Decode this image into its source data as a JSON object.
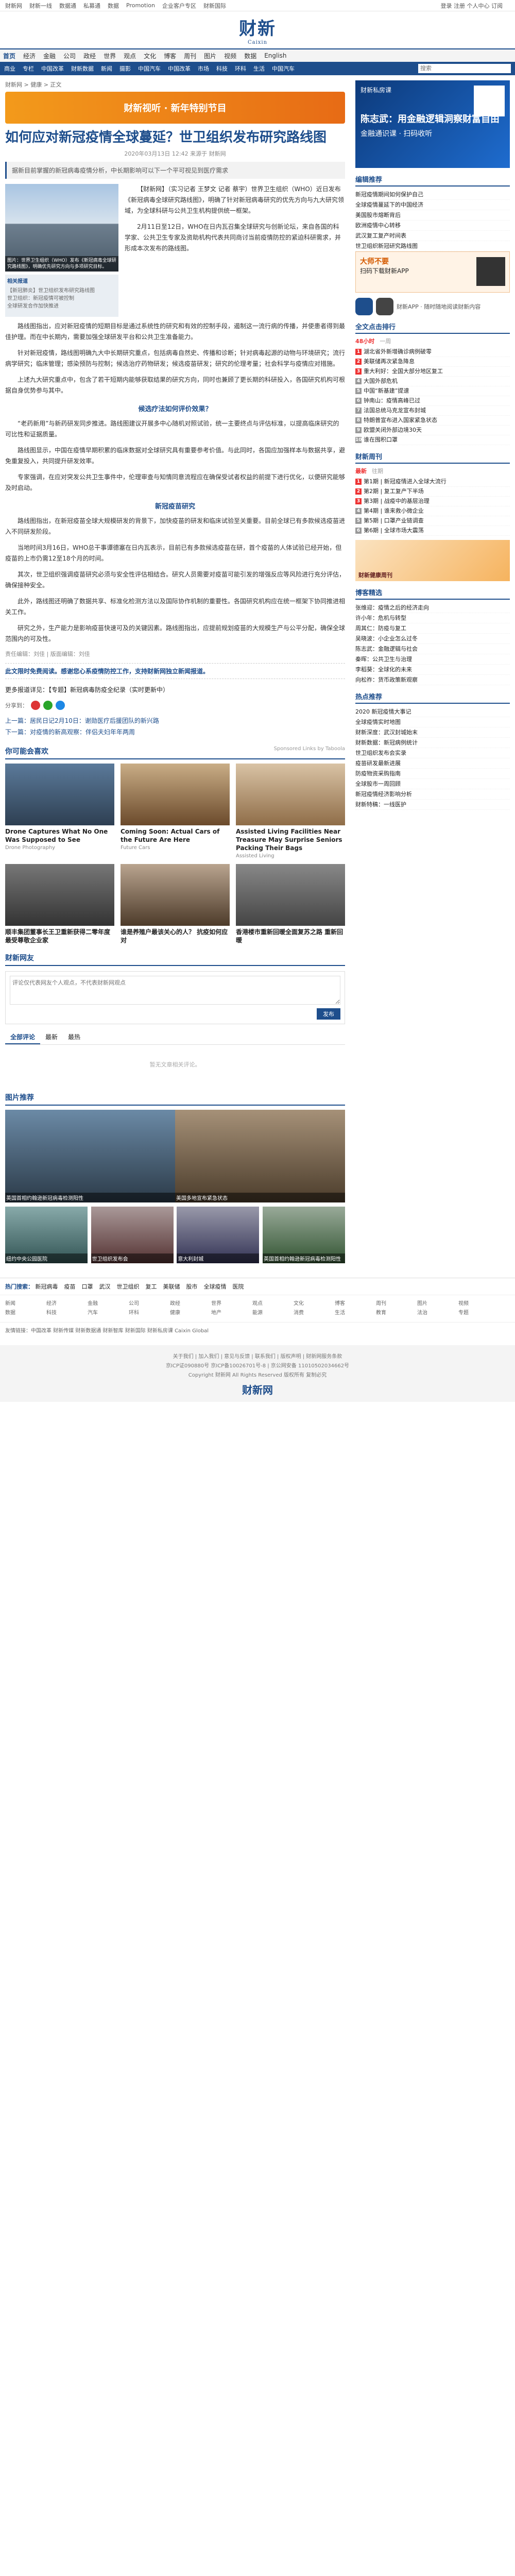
{
  "topbar": {
    "items": [
      "财新网",
      "财新一线",
      "数据通",
      "私募通",
      "数据",
      "Promotion",
      "企业客户专区",
      "财新国际"
    ],
    "right": "登录  注册  个人中心  订阅"
  },
  "logo": {
    "cn": "财新",
    "en": "Caixin"
  },
  "nav": {
    "items": [
      "首页",
      "经济",
      "金融",
      "公司",
      "政经",
      "世界",
      "观点",
      "文化",
      "博客",
      "周刊",
      "图片",
      "视频",
      "数据",
      "English"
    ],
    "sub": [
      "商业",
      "专栏",
      "中国改革",
      "财新数据",
      "新闻",
      "摄影",
      "中国汽车",
      "中国改革",
      "市场",
      "科技",
      "环科",
      "生活",
      "中国汽车"
    ]
  },
  "search": {
    "placeholder": "搜索"
  },
  "breadcrumb": "财新网 > 健康 > 正文",
  "ad_strip": "财新视听 · 新年特别节目",
  "article": {
    "title": "如何应对新冠疫情全球蔓延？世卫组织发布研究路线图",
    "meta": "2020年03月13日 12:42  来源于 财新网",
    "summary": "据新目前掌握的新冠病毒疫情分析，中长期影响可以下一个平可视见到医疗需求",
    "photo_caption": "图片：世界卫生组织（WHO）发布《新冠病毒全球研究路线图》，明确优先研究方向与多项研究目标。",
    "related_head": "相关报道",
    "related": [
      "【新冠肺炎】世卫组织发布研究路线图",
      "世卫组织：新冠疫情可被控制",
      "全球研发合作加快推进"
    ],
    "paragraphs": [
      "【财新网】（实习记者 王梦文 记者 蔡宇）世界卫生组织（WHO）近日发布《新冠病毒全球研究路线图》，明确了针对新冠病毒研究的优先方向与九大研究领域，为全球科研与公共卫生机构提供统一框架。",
      "2月11日至12日，WHO在日内瓦召集全球研究与创新论坛，来自各国的科学家、公共卫生专家及资助机构代表共同商讨当前疫情防控的紧迫科研需求，并形成本次发布的路线图。",
      "路线图指出，应对新冠疫情的短期目标是通过系统性的研究和有效的控制手段，遏制这一流行病的传播，并使患者得到最佳护理。而在中长期内，需要加强全球研发平台和公共卫生准备能力。",
      "针对新冠疫情，路线图明确九大中长期研究重点，包括病毒自然史、传播和诊断；针对病毒起源的动物与环境研究；流行病学研究；临床管理；感染预防与控制；候选治疗药物研发；候选疫苗研发；研究的伦理考量；社会科学与疫情应对措施。",
      "上述九大研究重点中，包含了若干短期内能够获取结果的研究方向，同时也兼顾了更长期的科研投入，各国研究机构可根据自身优势参与其中。"
    ],
    "h_mid": "候选疗法如何评价效果？",
    "paragraphs2": [
      "“老药新用”与新药研发同步推进。路线图建议开展多中心随机对照试验，统一主要终点与评估标准，以提高临床研究的可比性和证据质量。",
      "路线图显示，中国在疫情早期积累的临床数据对全球研究具有重要参考价值。与此同时，各国应加强样本与数据共享，避免重复投入，共同提升研发效率。",
      "专家强调，在应对突发公共卫生事件中，伦理审查与知情同意流程应在确保受试者权益的前提下进行优化，以便研究能够及时启动。"
    ],
    "h_mid2": "新冠疫苗研究",
    "paragraphs3": [
      "路线图指出，在新冠疫苗全球大规模研发的背景下，加快疫苗的研发和临床试验至关重要。目前全球已有多款候选疫苗进入不同研发阶段。",
      "当地时间3月16日，WHO总干事谭德塞在日内瓦表示，目前已有多款候选疫苗在研，首个疫苗的人体试验已经开始，但疫苗的上市仍需12至18个月的时间。",
      "其次，世卫组织强调疫苗研究必须与安全性评估相结合。研究人员需要对疫苗可能引发的增强反应等风险进行充分评估，确保接种安全。",
      "此外，路线图还明确了数据共享、标准化检测方法以及国际协作机制的重要性。各国研究机构应在统一框架下协同推进相关工作。",
      "研究之外，生产能力是影响疫苗快速可及的关键因素。路线图指出，应提前规划疫苗的大规模生产与公平分配，确保全球范围内的可及性。"
    ],
    "editor": "责任编辑：刘佳  |  版面编辑：刘佳",
    "notice": "此文限时免费阅读。感谢您心系疫情防控工作，支持财新网独立新闻报道。",
    "more_label": "更多报道详见：【专题】新冠病毒防疫全纪录（实时更新中）"
  },
  "share": {
    "label": "分享到："
  },
  "links": {
    "prev": "上一篇：居民日记2月10日：谢勋医疗后援团队的新兴路",
    "next": "下一篇：对疫情的新高观察：伴侣夫妇年年两周"
  },
  "recommend": {
    "title": "你可能会喜欢",
    "sponsored": "Sponsored Links by Taboola",
    "cards": [
      {
        "t": "Drone Captures What No One Was Supposed to See",
        "s": "Drone Photography"
      },
      {
        "t": "Coming Soon: Actual Cars of the Future Are Here",
        "s": "Future Cars"
      },
      {
        "t": "Assisted Living Facilities Near Treasure May Surprise Seniors Packing Their Bags",
        "s": "Assisted Living"
      }
    ],
    "cards2": [
      {
        "t": "顺丰集团董事长王卫重新获得二零年度最受尊敬企业家",
        "s": ""
      },
      {
        "t": "谁是养殖户最该关心的人？ 抗疫如何应对",
        "s": ""
      },
      {
        "t": "香港楼市重新回暖全面复苏之路 重新回暖",
        "s": ""
      }
    ]
  },
  "comments": {
    "title": "财新网友",
    "placeholder": "评论仅代表网友个人观点，不代表财新网观点",
    "submit": "发布",
    "tabs": [
      "全部评论",
      "最新",
      "最热"
    ],
    "empty": "暂无文章相关评论。"
  },
  "photos": {
    "title": "图片推荐",
    "items": [
      "英国首相约翰逊新冠病毒检测阳性",
      "美国多地宣布紧急状态",
      "纽约中央公园医院",
      "世卫组织发布会",
      "意大利封城"
    ]
  },
  "sidebar": {
    "ad1": {
      "top": "财新私房课",
      "big": "陈志武：用金融逻辑洞察财富自由",
      "mid": "金融通识课 · 扫码收听"
    },
    "hot_title": "编辑推荐",
    "hot": [
      "新冠疫情期间如何保护自己",
      "全球疫情蔓延下的中国经济",
      "美国股市熔断背后",
      "欧洲疫情中心转移",
      "武汉复工复产时间表",
      "世卫组织新冠研究路线图"
    ],
    "ad2": {
      "b": "大师不要",
      "s": "扫码下载财新APP"
    },
    "app_label": "财新APP · 随时随地阅读财新内容",
    "rank_title": "全文点击排行",
    "rank_tabs": [
      "48小时",
      "一周"
    ],
    "rank": [
      "湖北省外新增确诊病例破零",
      "美联储再次紧急降息",
      "重大利好：全国大部分地区复工",
      "大国外部危机",
      "中国“新基建”提速",
      "钟南山：疫情高峰已过",
      "法国总统马克龙宣布封城",
      "特朗普宣布进入国家紧急状态",
      "欧盟关闭外部边境30天",
      "谁在囤积口罩"
    ],
    "latest_title": "财新周刊",
    "latest_tabs": [
      "最新",
      "往期"
    ],
    "latest": [
      "第1期 | 新冠疫情进入全球大流行",
      "第2期 | 复工复产下半场",
      "第3期 | 战疫中的基层治理",
      "第4期 | 谁来救小微企业",
      "第5期 | 口罩产业链调查",
      "第6期 | 全球市场大震荡"
    ],
    "img_label": "财新健康周刊",
    "blog_title": "博客精选",
    "blog": [
      "张维迎：疫情之后的经济走向",
      "许小年：危机与转型",
      "周其仁：防疫与复工",
      "吴晓波：小企业怎么过冬",
      "陈志武：金融逻辑与社会",
      "秦晖：公共卫生与治理",
      "李稻葵：全球化的未来",
      "向松祚：货币政策新观察"
    ],
    "more_title": "热点推荐",
    "more": [
      "2020 新冠疫情大事记",
      "全球疫情实时地图",
      "财新深度：武汉封城始末",
      "财新数据：新冠病例统计",
      "世卫组织发布会实录",
      "疫苗研发最新进展",
      "防疫物资采购指南",
      "全球股市一周回顾",
      "新冠疫情经济影响分析",
      "财新特稿：一线医护"
    ]
  },
  "hot_links": {
    "label": "热门搜索：",
    "items": [
      "新冠病毒",
      "疫苗",
      "口罩",
      "武汉",
      "世卫组织",
      "复工",
      "美联储",
      "股市",
      "全球疫情",
      "医院"
    ]
  },
  "sitemap": {
    "rows": [
      [
        "新闻",
        "经济",
        "金融",
        "公司",
        "政经",
        "世界",
        "观点",
        "文化",
        "博客",
        "周刊",
        "图片",
        "视频"
      ],
      [
        "数据",
        "科技",
        "汽车",
        "环科",
        "健康",
        "地产",
        "能源",
        "消费",
        "生活",
        "教育",
        "法治",
        "专题"
      ]
    ]
  },
  "friend": "友情链接：中国改革  财新传媒  财新数据通  财新智库  财新国际  财新私房课  Caixin Global",
  "footer": {
    "lines": [
      "关于我们 | 加入我们 | 意见与反馈 | 联系我们 | 版权声明 | 财新网服务条款",
      "京ICP证090880号 京ICP备10026701号-8 | 京公网安备 11010502034662号",
      "Copyright 财新网 All Rights Reserved 版权所有 复制必究"
    ],
    "logo": "财新网"
  }
}
